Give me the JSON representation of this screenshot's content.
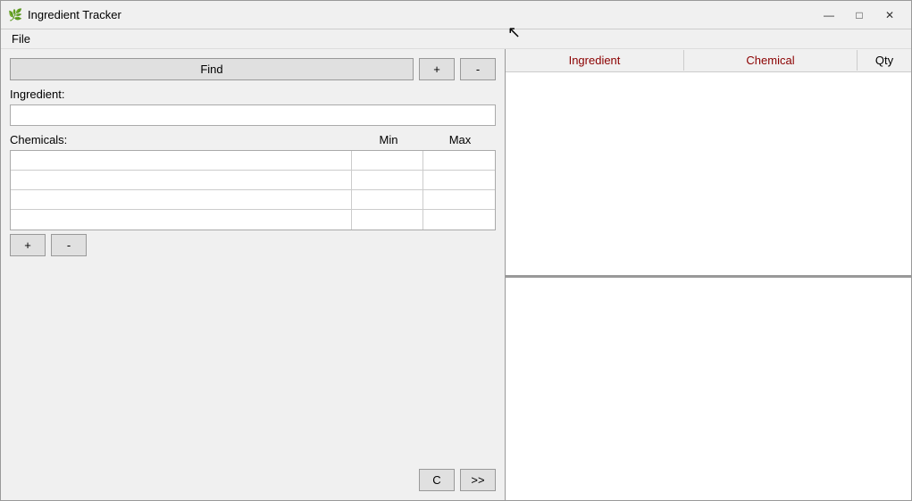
{
  "window": {
    "title": "Ingredient Tracker",
    "icon": "🌿"
  },
  "titlebar": {
    "minimize": "—",
    "maximize": "□",
    "close": "✕"
  },
  "menu": {
    "file": "File"
  },
  "left": {
    "find_label": "Find",
    "add_label": "+",
    "remove_label": "-",
    "ingredient_label": "Ingredient:",
    "ingredient_placeholder": "",
    "chemicals_label": "Chemicals:",
    "min_label": "Min",
    "max_label": "Max",
    "chem_add_label": "+",
    "chem_remove_label": "-",
    "clear_label": "C",
    "next_label": ">>"
  },
  "right": {
    "col_ingredient": "Ingredient",
    "col_chemical": "Chemical",
    "col_qty": "Qty"
  },
  "chemicals_rows": [
    {
      "name": "",
      "min": "",
      "max": ""
    },
    {
      "name": "",
      "min": "",
      "max": ""
    },
    {
      "name": "",
      "min": "",
      "max": ""
    },
    {
      "name": "",
      "min": "",
      "max": ""
    }
  ]
}
